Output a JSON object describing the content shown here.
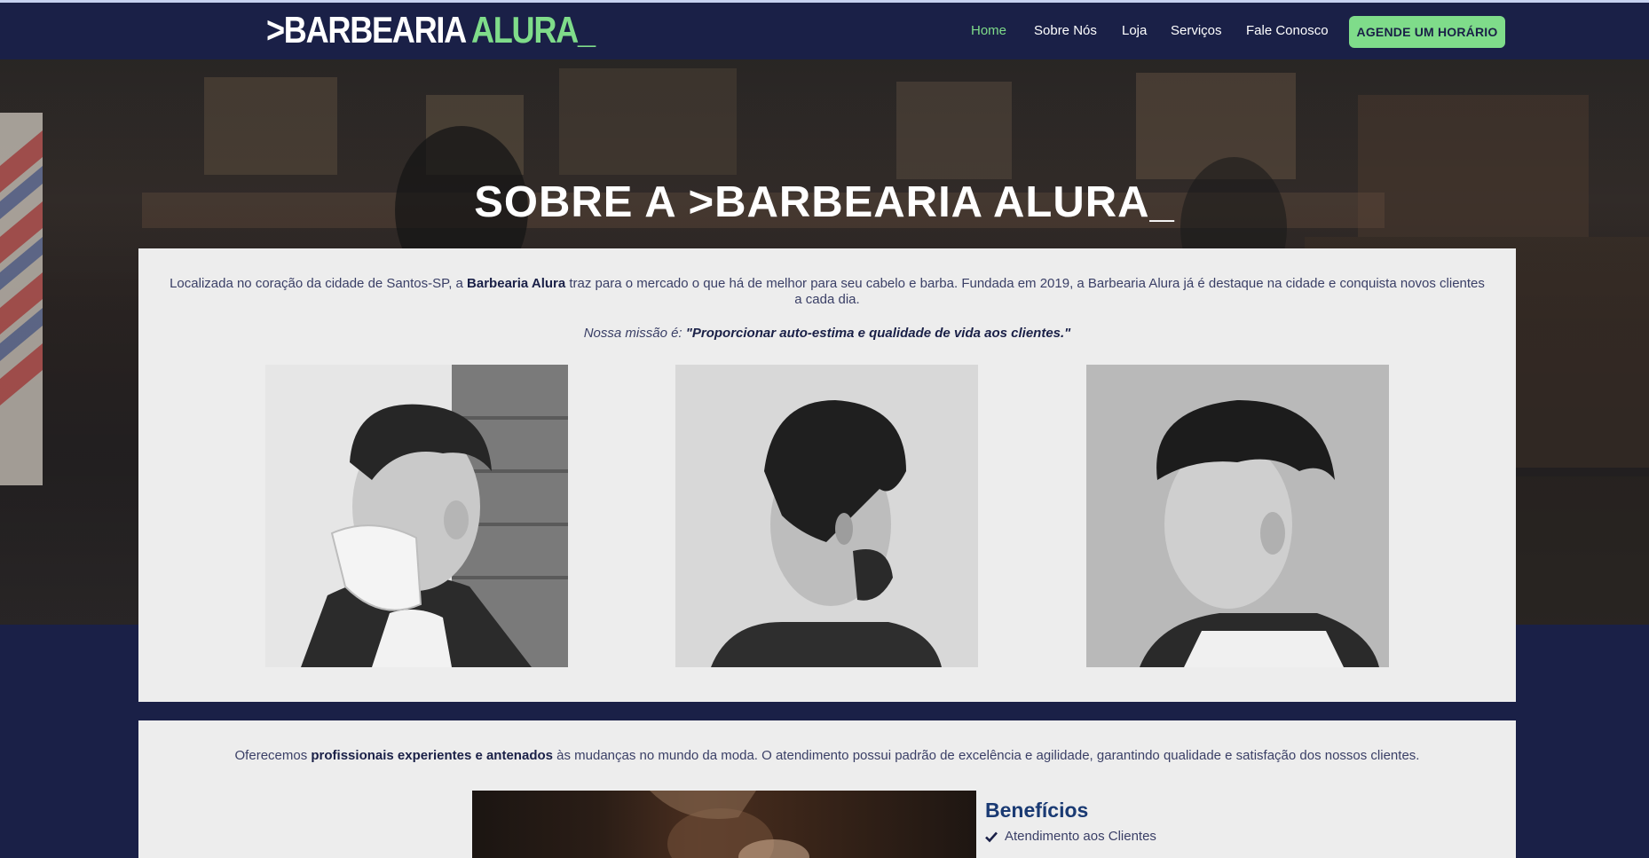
{
  "header": {
    "logo": {
      "part1": ">BARBEARIA",
      "part2": "ALURA_"
    },
    "nav": [
      {
        "label": "Home",
        "active": true
      },
      {
        "label": "Sobre Nós",
        "active": false
      },
      {
        "label": "Loja",
        "active": false
      },
      {
        "label": "Serviços",
        "active": false
      },
      {
        "label": "Fale Conosco",
        "active": false
      }
    ],
    "cta_label": "AGENDE UM HORÁRIO"
  },
  "hero": {
    "title": "SOBRE A >BARBEARIA ALURA_"
  },
  "about": {
    "intro_before": "Localizada no coração da cidade de Santos-SP, a ",
    "intro_bold": "Barbearia Alura",
    "intro_after": " traz para o mercado o que há de melhor para seu cabelo e barba. Fundada em 2019, a Barbearia Alura já é destaque na cidade e conquista novos clientes a cada dia.",
    "mission_label": "Nossa missão é: ",
    "mission_text": "\"Proporcionar auto-estima e qualidade de vida aos clientes.\""
  },
  "services": {
    "offer_before": "Oferecemos ",
    "offer_bold": "profissionais experientes e antenados",
    "offer_after": " às mudanças no mundo da moda. O atendimento possui padrão de excelência e agilidade, garantindo qualidade e satisfação dos nossos clientes.",
    "benefits_title": "Benefícios",
    "benefits": [
      "Atendimento aos Clientes"
    ]
  },
  "colors": {
    "navy": "#1a2047",
    "accent_green": "#7fdc8a",
    "card_bg": "#ededed",
    "benefits_blue": "#1a3a73"
  },
  "icons": [
    "check-icon"
  ]
}
